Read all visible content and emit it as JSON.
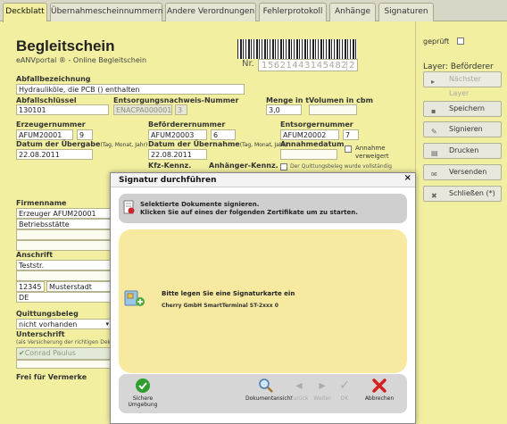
{
  "tabs": [
    "Deckblatt",
    "Übernahmescheinnummern",
    "Andere Verordnungen",
    "Fehlerprotokoll",
    "Anhänge",
    "Signaturen"
  ],
  "header": {
    "title": "Begleitschein",
    "subtitle": "eANVportal ® - Online Begleitschein",
    "nr_label": "Nr.",
    "nr_value": "15621443145482",
    "nr_suffix": "2"
  },
  "form": {
    "abfallbezeichnung_label": "Abfallbezeichnung",
    "abfallbezeichnung": "Hydrauliköle, die PCB () enthalten",
    "abfallschluessel_label": "Abfallschlüssel",
    "abfallschluessel": "130101",
    "entsorgungsnachweis_label": "Entsorgungsnachweis-Nummer",
    "entsorgungsnachweis": "ENACPA000001",
    "entsorgungsnachweis_suffix": "3",
    "menge_label": "Menge in t",
    "menge": "3,0",
    "volumen_label": "Volumen in cbm",
    "volumen": "",
    "erzeuger_label": "Erzeugernummer",
    "erzeuger": "AFUM20001",
    "erzeuger_suffix": "9",
    "datum_uebergabe_label": "Datum der Übergabe",
    "datum_hint": "(Tag, Monat, Jahr)",
    "datum_uebergabe": "22.08.2011",
    "befoerderer_label": "Beförderernummer",
    "befoerderer": "AFUM20003",
    "befoerderer_suffix": "6",
    "datum_uebernahme_label": "Datum der Übernahme",
    "datum_uebernahme": "22.08.2011",
    "kfz_label": "Kfz-Kennz.",
    "anhaenger_label": "Anhänger-Kennz.",
    "entsorger_label": "Entsorgernummer",
    "entsorger": "AFUM20002",
    "entsorger_suffix": "7",
    "annahmedatum_label": "Annahmedatum",
    "annahme_verweigert": "Annahme verweigert",
    "quittung_hint": "Der Quittungsbeleg wurde vollständig",
    "firmenname_label": "Firmenname",
    "firmenname": "Erzeuger AFUM20001",
    "betriebsstaette": "Betriebsstätte",
    "anschrift_label": "Anschrift",
    "strasse": "Teststr.",
    "plz": "12345",
    "ort": "Musterstadt",
    "land": "DE",
    "quittungsbeleg_label": "Quittungsbeleg",
    "quittungsbeleg": "nicht vorhanden",
    "unterschrift_label": "Unterschrift",
    "unterschrift_hint": "(als Versicherung der richtigen Dekla",
    "unterschrift": "Conrad Paulus",
    "vermerke_label": "Frei für Vermerke"
  },
  "sidebar": {
    "geprueft": "geprüft",
    "layer": "Layer: Beförderer",
    "naechster_layer": "Nächster Layer",
    "buttons": [
      "Speichern",
      "Signieren",
      "Drucken",
      "Versenden",
      "Schließen (*)"
    ]
  },
  "modal": {
    "title": "Signatur durchführen",
    "info_line1": "Selektierte Dokumente signieren.",
    "info_line2": "Klicken Sie auf eines der folgenden Zertifikate um zu starten.",
    "card_line1": "Bitte legen Sie eine Signaturkarte ein",
    "card_line2": "Cherry GmbH SmartTerminal ST-2xxx 0",
    "footer": {
      "sichere_umgebung": "Sichere Umgebung",
      "dokumentansicht": "Dokumentansicht",
      "zurueck": "Zurück",
      "weiter": "Weiter",
      "ok": "OK",
      "abbrechen": "Abbrechen"
    }
  },
  "colors": {
    "paper": "#f2f0a0",
    "modal_panel": "#f7e9a0",
    "ok_green": "#2e9e2e",
    "cancel_red": "#d42020"
  }
}
